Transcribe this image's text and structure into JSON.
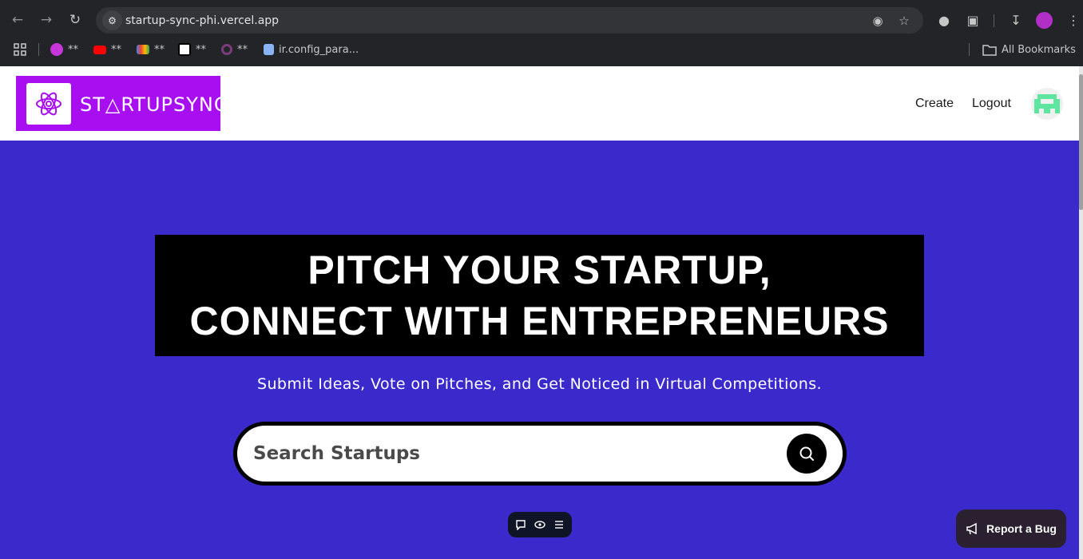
{
  "browser": {
    "url": "startup-sync-phi.vercel.app",
    "bookmarks": [
      {
        "label": "**",
        "color": "#c636d9"
      },
      {
        "label": "**",
        "color": "#ff0000"
      },
      {
        "label": "**",
        "color": "#ea4335"
      },
      {
        "label": "**",
        "color": "#ffffff"
      },
      {
        "label": "**",
        "color": "#7a3d7a"
      },
      {
        "label": "ir.config_para...",
        "color": "#8ab4f8"
      }
    ],
    "all_bookmarks_label": "All Bookmarks"
  },
  "header": {
    "logo_text": "ST△RTUPSYNC",
    "brand_color": "#a80ff0",
    "nav": {
      "create_label": "Create",
      "logout_label": "Logout"
    }
  },
  "hero": {
    "background": "#3b2acb",
    "headline_line1": "PITCH YOUR STARTUP,",
    "headline_line2": "CONNECT WITH ENTREPRENEURS",
    "subtitle": "Submit Ideas, Vote on Pitches, and Get Noticed in Virtual Competitions.",
    "search": {
      "placeholder": "Search Startups"
    }
  },
  "report_bug": {
    "label": "Report a Bug"
  }
}
